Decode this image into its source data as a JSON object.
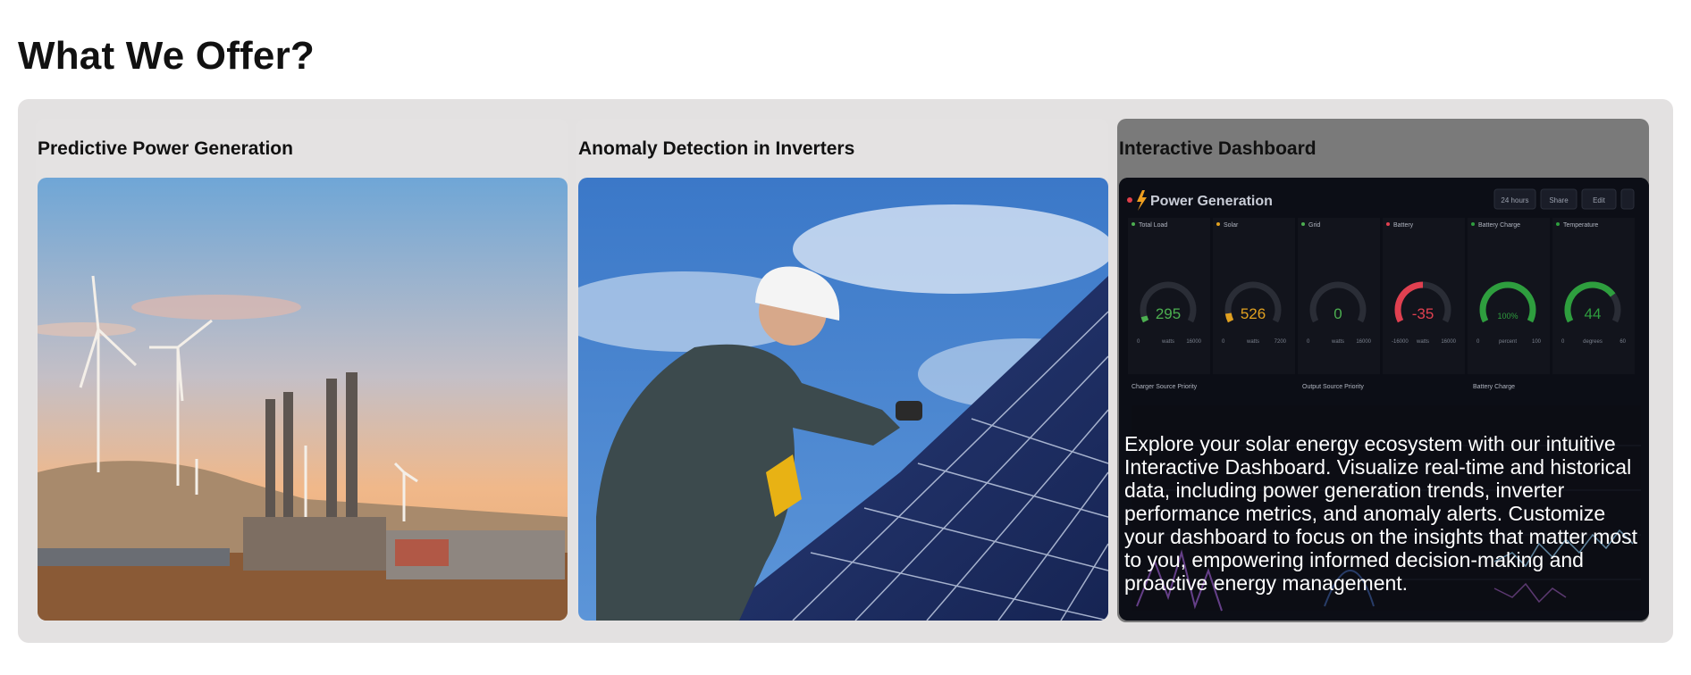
{
  "page": {
    "title": "What We Offer?"
  },
  "cards": [
    {
      "title": "Predictive Power Generation",
      "image": "power-plant-wind-turbines-photo"
    },
    {
      "title": "Anomaly Detection in Inverters",
      "image": "technician-solar-panel-photo"
    },
    {
      "title": "Interactive Dashboard",
      "image": "power-generation-dashboard-screenshot",
      "description": "Explore your solar energy ecosystem with our intuitive Interactive Dashboard. Visualize real-time and historical data, including power generation trends, inverter performance metrics, and anomaly alerts. Customize your dashboard to focus on the insights that matter most to you, empowering informed decision-making and proactive energy management."
    }
  ],
  "dashboard": {
    "title": "Power Generation",
    "buttons": [
      "24 hours",
      "Share",
      "Edit"
    ],
    "gauges": [
      {
        "label": "Total Load",
        "value": "295",
        "unit": "watts",
        "min": "0",
        "max": "16000",
        "fill": 0.05,
        "color": "#4caf50"
      },
      {
        "label": "Solar",
        "value": "526",
        "unit": "watts",
        "min": "0",
        "max": "7200",
        "fill": 0.08,
        "color": "#e0a020"
      },
      {
        "label": "Grid",
        "value": "0",
        "unit": "watts",
        "min": "0",
        "max": "16000",
        "fill": 0.0,
        "color": "#4caf50"
      },
      {
        "label": "Battery",
        "value": "-35",
        "unit": "watts",
        "min": "-16000",
        "max": "16000",
        "fill": 0.5,
        "color": "#e04050"
      },
      {
        "label": "Battery Charge",
        "value": "100%",
        "unit": "percent",
        "min": "0",
        "max": "100",
        "fill": 1.0,
        "color": "#2e9e3e"
      },
      {
        "label": "Temperature",
        "value": "44",
        "unit": "degrees",
        "min": "0",
        "max": "60",
        "fill": 0.73,
        "color": "#2e9e3e"
      }
    ],
    "section_labels": [
      "Charger Source Priority",
      "Output Source Priority",
      "Battery Charge"
    ],
    "colors": {
      "background": "#0c0e16",
      "panel": "#12141c",
      "text": "#c8ccd6"
    }
  }
}
